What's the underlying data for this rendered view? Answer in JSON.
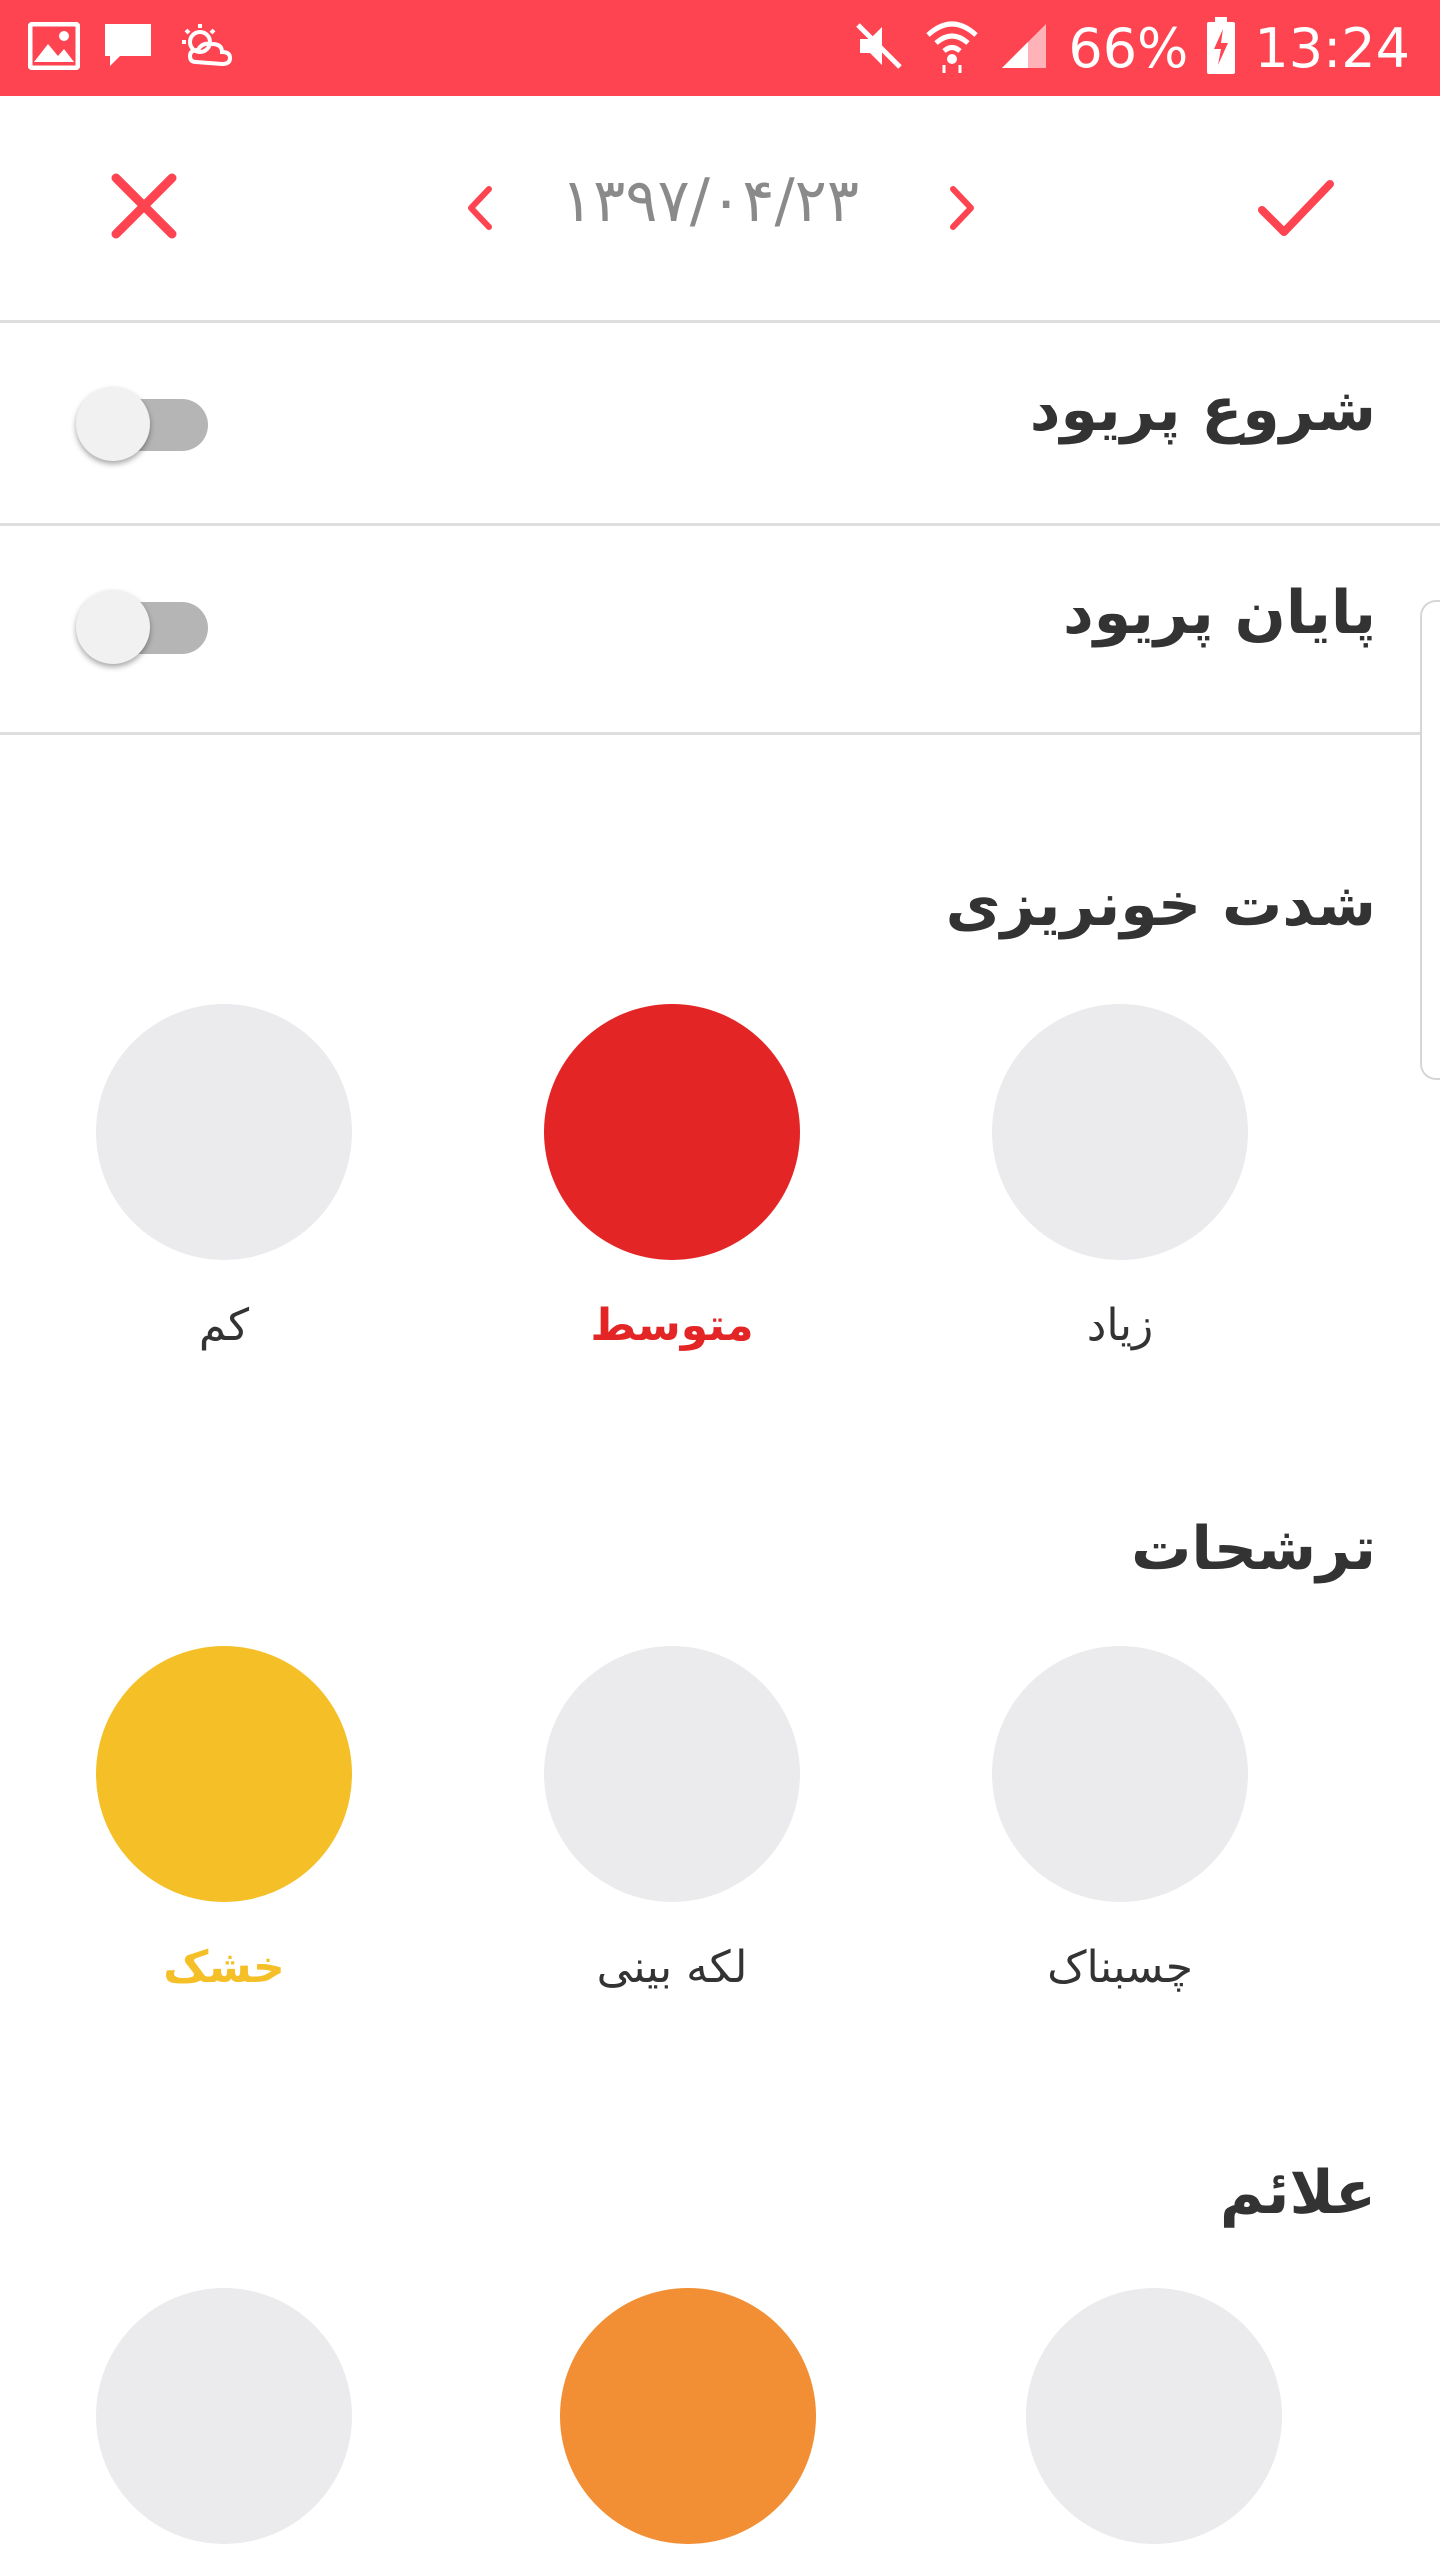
{
  "status_bar": {
    "battery": "66%",
    "time": "13:24",
    "icons": [
      "gallery-icon",
      "message-icon",
      "weather-icon",
      "mute-icon",
      "wifi-icon",
      "signal-icon",
      "battery-charging-icon"
    ]
  },
  "header": {
    "date": "۱۳۹۷/۰۴/۲۳",
    "icons": [
      "close-icon",
      "chevron-left-icon",
      "chevron-right-icon",
      "check-icon"
    ]
  },
  "toggles": [
    {
      "label": "شروع پریود",
      "checked": false
    },
    {
      "label": "پایان پریود",
      "checked": false
    }
  ],
  "sections": [
    {
      "title": "شدت خونریزی",
      "options": [
        {
          "label": "زیاد",
          "selected": false
        },
        {
          "label": "متوسط",
          "selected": true,
          "color": "#e32526"
        },
        {
          "label": "کم",
          "selected": false
        }
      ]
    },
    {
      "title": "ترشحات",
      "options": [
        {
          "label": "چسبناک",
          "selected": false
        },
        {
          "label": "لکه بینی",
          "selected": false
        },
        {
          "label": "خشک",
          "selected": true,
          "color": "#f5bf27"
        }
      ]
    },
    {
      "title": "علائم",
      "options": [
        {
          "label": "",
          "selected": false
        },
        {
          "label": "",
          "selected": true,
          "color": "#f28e33"
        },
        {
          "label": "",
          "selected": false
        }
      ]
    }
  ],
  "colors": {
    "accent": "#fe4451",
    "unselected_circle": "#ebebed",
    "text": "#333333",
    "date_text": "#8a8a8a"
  }
}
